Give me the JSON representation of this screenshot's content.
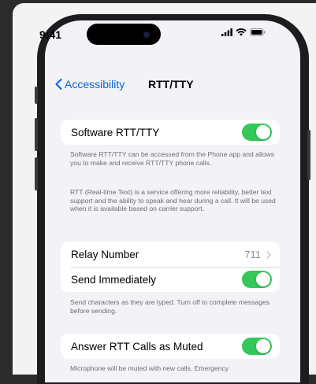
{
  "status": {
    "time": "9:41"
  },
  "nav": {
    "back_label": "Accessibility",
    "title": "RTT/TTY"
  },
  "section1": {
    "toggle_label": "Software RTT/TTY",
    "toggle_on": true,
    "note1": "Software RTT/TTY can be accessed from the Phone app and allows you to make and receive RTT/TTY phone calls.",
    "note2": "RTT (Real-time Text) is a service offering more reliability, better text support and the ability to speak and hear during a call. It will be used when it is available based on carrier support."
  },
  "section2": {
    "relay_label": "Relay Number",
    "relay_value": "711",
    "send_label": "Send Immediately",
    "send_on": true,
    "note": "Send characters as they are typed. Turn off to complete messages before sending."
  },
  "section3": {
    "answer_label": "Answer RTT Calls as Muted",
    "answer_on": true,
    "note": "Microphone will be muted with new calls. Emergency"
  },
  "colors": {
    "accent": "#0a64d8",
    "toggle_on": "#34c759"
  }
}
